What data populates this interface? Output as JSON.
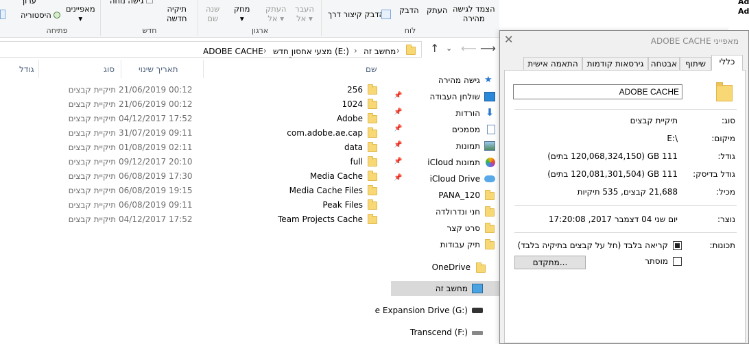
{
  "ribbon": {
    "groups": {
      "clipboard": "לוח",
      "organize": "ארגון",
      "new": "חדש",
      "open": "פתיחה"
    },
    "pin_quick_access": "הצמד לגישה",
    "pin_quick_access_2": "מהירה",
    "copy": "העתק",
    "paste": "הדבק",
    "paste_shortcut": "הדבק קיצור דרך",
    "move_to": "העבר",
    "move_to_2": "אל",
    "copy_to": "העתק",
    "copy_to_2": "אל",
    "delete": "מחק",
    "rename": "שנה",
    "rename_2": "שם",
    "new_folder": "תיקיה",
    "new_folder_2": "חדשה",
    "easy_access": "גישה נוחה",
    "properties": "מאפיינים",
    "history": "היסטוריה",
    "edit": "ערוך"
  },
  "address": {
    "crumbs": [
      "מחשב זה",
      "מצעי אחסון חדש (E:)",
      "ADOBE CACHE"
    ]
  },
  "columns": {
    "name": "שם",
    "date": "תאריך שינוי",
    "type": "סוג",
    "size": "גודל"
  },
  "files": [
    {
      "name": "256",
      "date": "21/06/2019 00:12",
      "type": "תיקיית קבצים"
    },
    {
      "name": "1024",
      "date": "21/06/2019 00:12",
      "type": "תיקיית קבצים"
    },
    {
      "name": "Adobe",
      "date": "04/12/2017 17:52",
      "type": "תיקיית קבצים"
    },
    {
      "name": "com.adobe.ae.cap",
      "date": "31/07/2019 09:11",
      "type": "תיקיית קבצים"
    },
    {
      "name": "data",
      "date": "01/08/2019 02:11",
      "type": "תיקיית קבצים"
    },
    {
      "name": "full",
      "date": "09/12/2017 20:10",
      "type": "תיקיית קבצים"
    },
    {
      "name": "Media Cache",
      "date": "06/08/2019 17:30",
      "type": "תיקיית קבצים"
    },
    {
      "name": "Media Cache Files",
      "date": "06/08/2019 19:15",
      "type": "תיקיית קבצים"
    },
    {
      "name": "Peak Files",
      "date": "06/08/2019 09:11",
      "type": "תיקיית קבצים"
    },
    {
      "name": "Team Projects Cache",
      "date": "04/12/2017 17:52",
      "type": "תיקיית קבצים"
    }
  ],
  "nav": {
    "quick_access": "גישה מהירה",
    "items": [
      "שולחן העבודה",
      "הורדות",
      "מסמכים",
      "תמונות",
      "תמונות iCloud",
      "iCloud Drive",
      "PANA_120",
      "חני ונדרולדה",
      "סרט קצר",
      "תיק עבודות"
    ],
    "onedrive": "OneDrive",
    "this_pc": "מחשב זה",
    "drive_g": "e Expansion Drive (G:)",
    "drive_f": "Transcend (F:)"
  },
  "props": {
    "title": "מאפייני ADOBE CACHE",
    "tabs": [
      "כללי",
      "שיתוף",
      "אבטחה",
      "גירסאות קודמות",
      "התאמה אישית"
    ],
    "name": "ADOBE CACHE",
    "type_label": "סוג:",
    "type_value": "תיקיית קבצים",
    "location_label": "מיקום:",
    "location_value": "E:\\",
    "size_label": "גודל:",
    "size_value": "111 GB (120,068,324,150 בתים)",
    "disk_size_label": "גודל בדיסק:",
    "disk_size_value": "111 GB (120,081,301,504 בתים)",
    "contains_label": "מכיל:",
    "contains_value": "21,688 קבצים, 535 תיקיות",
    "created_label": "נוצר:",
    "created_value": "יום שני 04 דצמבר 2017, 17:20:08",
    "attributes_label": "תכונות:",
    "readonly_label": "קריאה בלבד (חל על קבצים בתיקיה בלבד)",
    "hidden_label": "מוסתר",
    "advanced_button": "מתקדם..."
  },
  "bg_window": {
    "line1": "Ad",
    "line2": "Ado"
  }
}
